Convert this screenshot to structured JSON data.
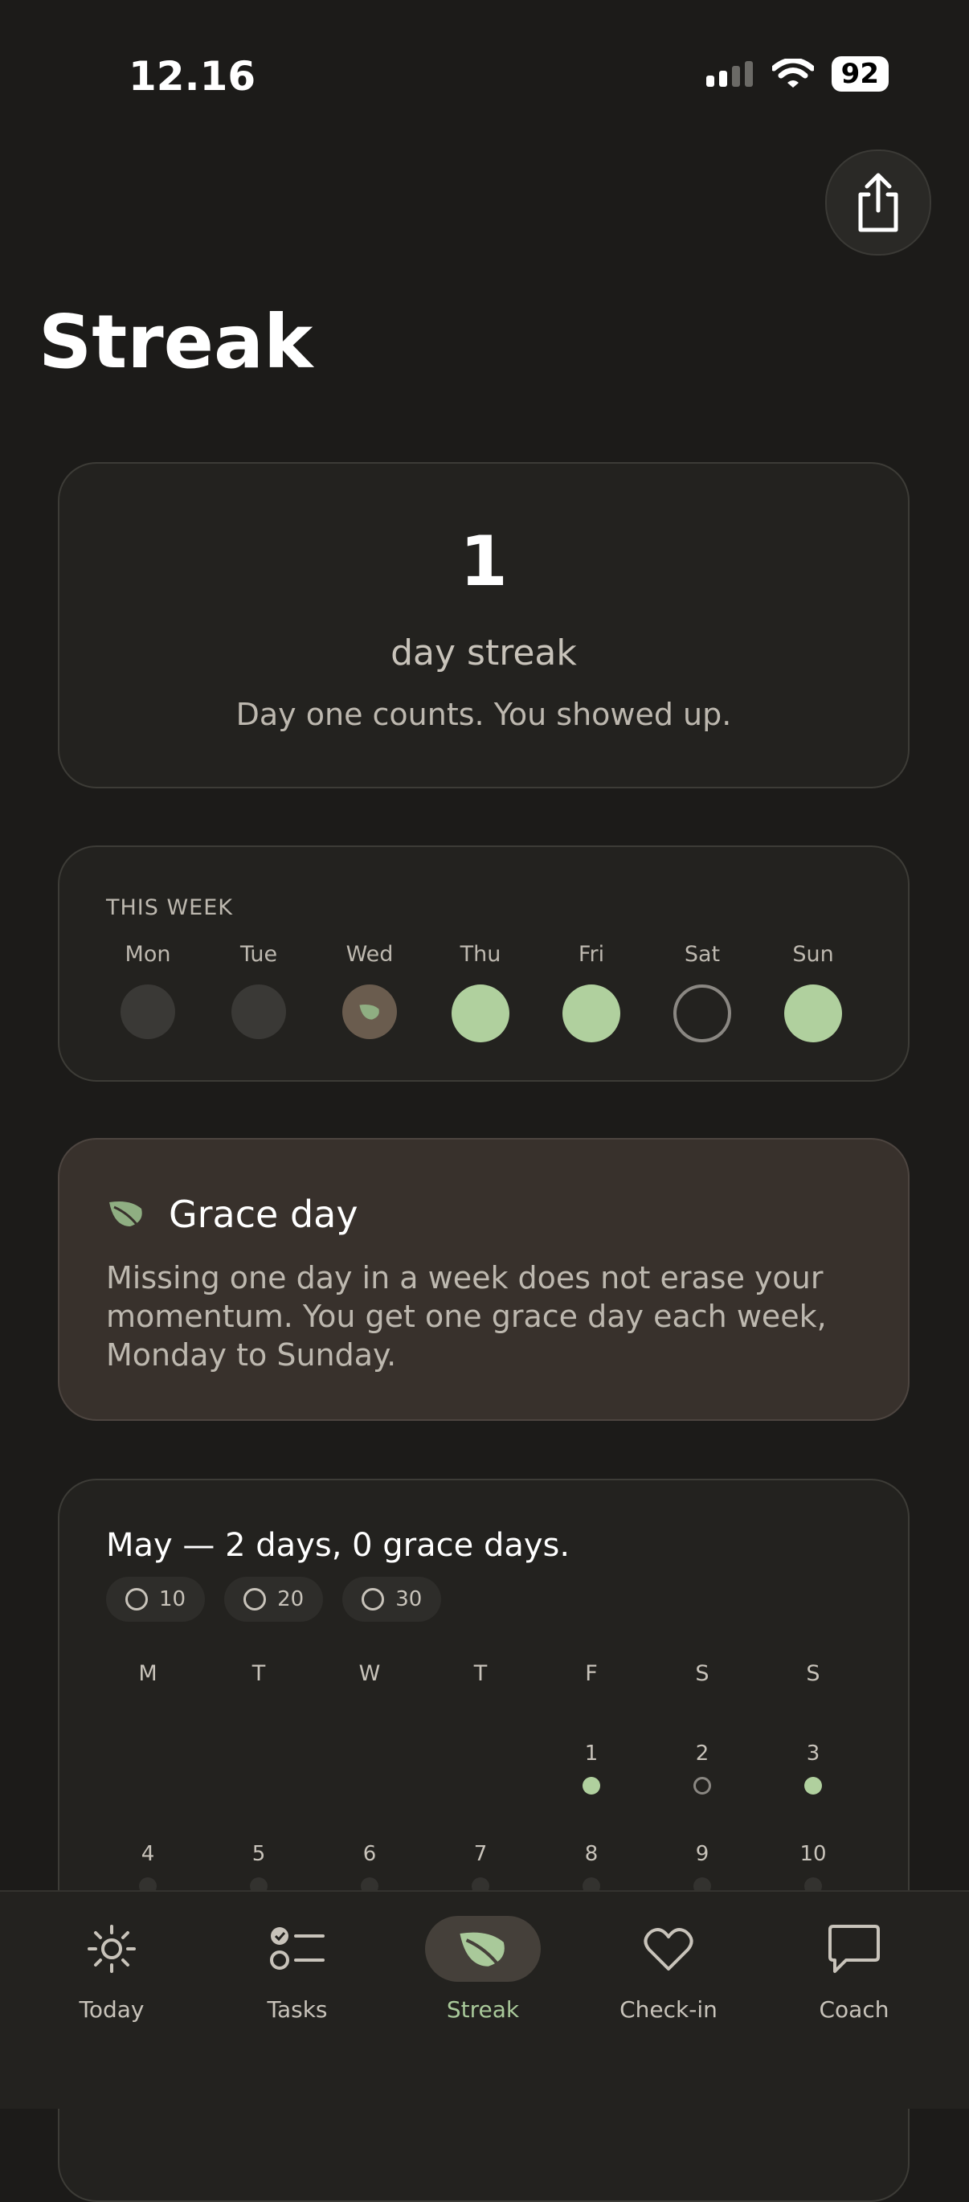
{
  "status": {
    "time": "12.16",
    "battery": "92"
  },
  "page": {
    "title": "Streak"
  },
  "streak": {
    "count": "1",
    "unit": "day streak",
    "message": "Day one counts. You showed up."
  },
  "week": {
    "label": "THIS WEEK",
    "days": [
      {
        "name": "Mon",
        "state": "empty"
      },
      {
        "name": "Tue",
        "state": "empty"
      },
      {
        "name": "Wed",
        "state": "grace"
      },
      {
        "name": "Thu",
        "state": "done"
      },
      {
        "name": "Fri",
        "state": "done"
      },
      {
        "name": "Sat",
        "state": "missed"
      },
      {
        "name": "Sun",
        "state": "done"
      }
    ]
  },
  "grace": {
    "title": "Grace day",
    "body": "Missing one day in a week does not erase your momentum. You get one grace day each week, Monday to Sunday."
  },
  "month": {
    "title": "May — 2 days, 0 grace days.",
    "chips": [
      "10",
      "20",
      "30"
    ],
    "weekdays": [
      "M",
      "T",
      "W",
      "T",
      "F",
      "S",
      "S"
    ],
    "days": [
      {
        "n": "1",
        "state": "done"
      },
      {
        "n": "2",
        "state": "missed"
      },
      {
        "n": "3",
        "state": "done"
      },
      {
        "n": "4",
        "state": "empty"
      },
      {
        "n": "5",
        "state": "empty"
      },
      {
        "n": "6",
        "state": "empty"
      },
      {
        "n": "7",
        "state": "empty"
      },
      {
        "n": "8",
        "state": "empty"
      },
      {
        "n": "9",
        "state": "empty"
      },
      {
        "n": "10",
        "state": "empty"
      }
    ]
  },
  "nav": {
    "items": [
      {
        "label": "Today",
        "icon": "sun-icon"
      },
      {
        "label": "Tasks",
        "icon": "checklist-icon"
      },
      {
        "label": "Streak",
        "icon": "leaf-icon",
        "active": true
      },
      {
        "label": "Check-in",
        "icon": "heart-icon"
      },
      {
        "label": "Coach",
        "icon": "chat-bubble-icon"
      }
    ]
  },
  "colors": {
    "accent": "#b0d09e",
    "background": "#1c1b19",
    "card": "#23221f",
    "grace_card": "#38312c"
  }
}
